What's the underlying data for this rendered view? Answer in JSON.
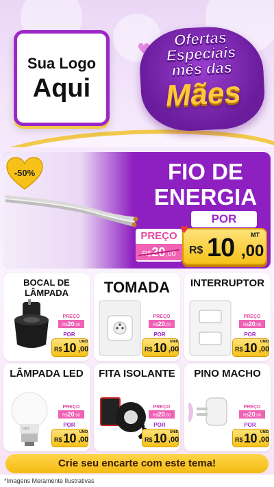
{
  "header": {
    "logo_line1": "Sua Logo",
    "logo_line2": "Aqui",
    "title_line1": "Ofertas",
    "title_line2": "Especiais",
    "title_line3": "mês das",
    "title_line4": "Mães"
  },
  "hero": {
    "discount": "-50%",
    "title_line1": "FIO DE",
    "title_line2": "ENERGIA",
    "preco_label": "PREÇO",
    "old_currency": "R$",
    "old_int": "20",
    "old_dec": ",00",
    "por_label": "POR",
    "currency": "R$",
    "price_int": "10",
    "price_dec": ",00",
    "unit": "MT"
  },
  "products": [
    {
      "name": "BOCAL DE LÂMPADA",
      "preco_label": "PREÇO",
      "old_currency": "R$",
      "old_int": "20",
      "old_dec": ",00",
      "por_label": "POR",
      "currency": "R$",
      "price_int": "10",
      "price_dec": ",00",
      "unit": "UNID"
    },
    {
      "name": "TOMADA",
      "preco_label": "PREÇO",
      "old_currency": "R$",
      "old_int": "20",
      "old_dec": ",00",
      "por_label": "POR",
      "currency": "R$",
      "price_int": "10",
      "price_dec": ",00",
      "unit": "UNID"
    },
    {
      "name": "INTERRUPTOR",
      "preco_label": "PREÇO",
      "old_currency": "R$",
      "old_int": "20",
      "old_dec": ",00",
      "por_label": "POR",
      "currency": "R$",
      "price_int": "10",
      "price_dec": ",00",
      "unit": "UNID"
    },
    {
      "name": "LÂMPADA LED",
      "preco_label": "PREÇO",
      "old_currency": "R$",
      "old_int": "20",
      "old_dec": ",00",
      "por_label": "POR",
      "currency": "R$",
      "price_int": "10",
      "price_dec": ",00",
      "unit": "UNID"
    },
    {
      "name": "FITA ISOLANTE",
      "preco_label": "PREÇO",
      "old_currency": "R$",
      "old_int": "20",
      "old_dec": ",00",
      "por_label": "POR",
      "currency": "R$",
      "price_int": "10",
      "price_dec": ",00",
      "unit": "UNID"
    },
    {
      "name": "PINO MACHO",
      "preco_label": "PREÇO",
      "old_currency": "R$",
      "old_int": "20",
      "old_dec": ",00",
      "por_label": "POR",
      "currency": "R$",
      "price_int": "10",
      "price_dec": ",00",
      "unit": "UNID"
    }
  ],
  "cta": {
    "label": "Crie seu encarte com este tema!"
  },
  "footer": {
    "note": "*Imagens Meramente Ilustrativas"
  },
  "colors": {
    "purple": "#8e1fc1",
    "yellow": "#f6c21a",
    "pink": "#ef62b4"
  },
  "icons": [
    "heart-icon",
    "cable-image",
    "socket-base-image",
    "outlet-image",
    "switch-image",
    "led-bulb-image",
    "tape-image",
    "plug-image"
  ]
}
